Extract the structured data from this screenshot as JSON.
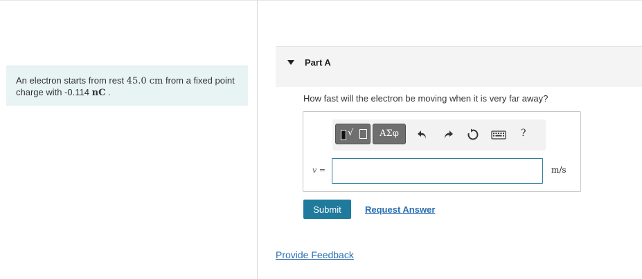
{
  "intro": {
    "text_a": "An electron starts from rest ",
    "distance_value": "45.0",
    "distance_unit": "cm",
    "text_b": " from a fixed point charge with ",
    "charge_value": "-0.114",
    "charge_unit": "nC",
    "text_end": " ."
  },
  "part": {
    "title": "Part A",
    "question": "How fast will the electron be moving when it is very far away?"
  },
  "toolbar": {
    "greek_label": "ΑΣφ",
    "help_label": "?",
    "icons": [
      "templates-icon",
      "greek-symbols-icon",
      "undo-icon",
      "redo-icon",
      "reset-icon",
      "keyboard-icon",
      "help-icon"
    ]
  },
  "answer": {
    "variable": "v",
    "equals": " =",
    "value": "",
    "units": "m/s"
  },
  "actions": {
    "submit_label": "Submit",
    "request_answer_label": "Request Answer",
    "feedback_label": "Provide Feedback"
  },
  "colors": {
    "accent": "#1f7a9c",
    "intro_bg": "#e8f3f3",
    "link": "#2a6fb0"
  }
}
